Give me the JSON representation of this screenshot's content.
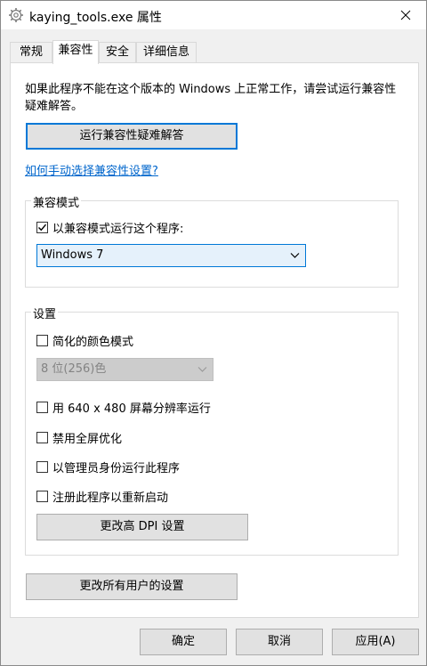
{
  "window": {
    "title": "kaying_tools.exe 属性"
  },
  "tabs": [
    {
      "label": "常规"
    },
    {
      "label": "兼容性"
    },
    {
      "label": "安全"
    },
    {
      "label": "详细信息"
    }
  ],
  "active_tab": "兼容性",
  "compat": {
    "intro_text": "如果此程序不能在这个版本的 Windows 上正常工作，请尝试运行兼容性疑难解答。",
    "troubleshoot_button": "运行兼容性疑难解答",
    "manual_link": "如何手动选择兼容性设置?",
    "mode_group_title": "兼容模式",
    "mode_checkbox_label": "以兼容模式运行这个程序:",
    "mode_checkbox_checked": true,
    "os_select_value": "Windows 7"
  },
  "settings": {
    "group_title": "设置",
    "reduced_color": {
      "label": "简化的颜色模式",
      "checked": false
    },
    "color_select_value": "8 位(256)色",
    "low_res": {
      "label": "用 640 x 480 屏幕分辨率运行",
      "checked": false
    },
    "disable_fullscreen": {
      "label": "禁用全屏优化",
      "checked": false
    },
    "run_as_admin": {
      "label": "以管理员身份运行此程序",
      "checked": false
    },
    "register_restart": {
      "label": "注册此程序以重新启动",
      "checked": false
    },
    "dpi_button": "更改高 DPI 设置"
  },
  "all_users_button": "更改所有用户的设置",
  "footer": {
    "ok": "确定",
    "cancel": "取消",
    "apply": "应用(A)"
  },
  "colors": {
    "accent": "#0078d7",
    "link": "#0066cc",
    "button_bg": "#e1e1e1"
  }
}
